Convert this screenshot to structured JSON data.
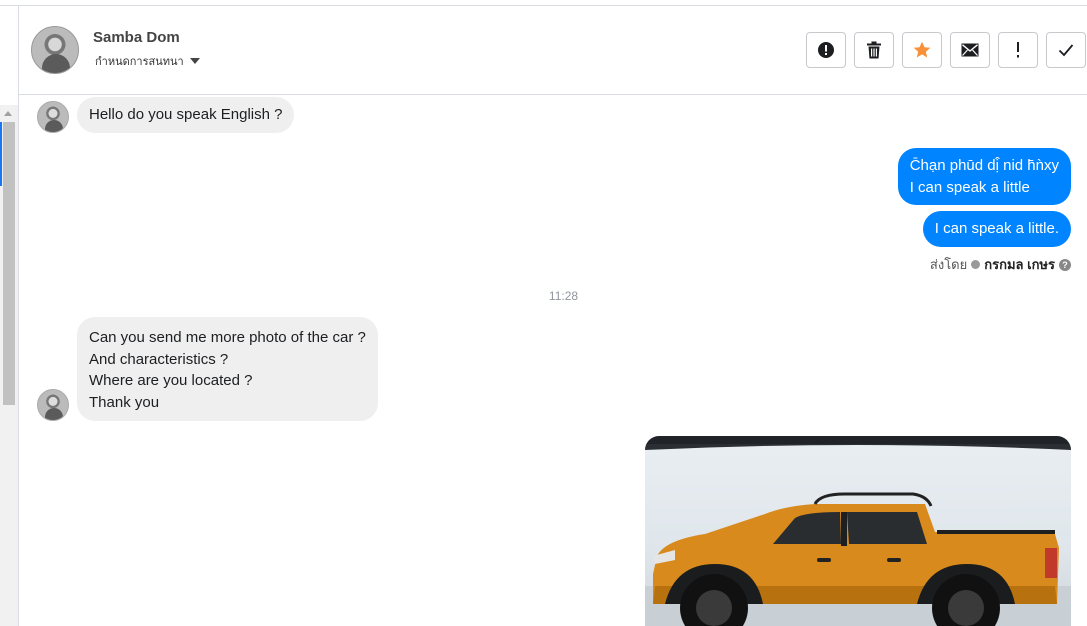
{
  "header": {
    "contact_name": "Samba Dom",
    "subtitle": "กำหนดการสนทนา",
    "actions": [
      {
        "name": "report-button",
        "icon": "exclamation-circle-icon"
      },
      {
        "name": "delete-button",
        "icon": "trash-icon"
      },
      {
        "name": "star-button",
        "icon": "star-icon",
        "color": "#f7923a"
      },
      {
        "name": "mark-unread-button",
        "icon": "envelope-icon"
      },
      {
        "name": "spam-button",
        "icon": "exclamation-icon"
      },
      {
        "name": "done-button",
        "icon": "check-icon"
      }
    ]
  },
  "messages": {
    "m1": "Hello do you speak English ?",
    "m2": "C̄hạn phūd dị̂ nid h̄ǹxy\nI can speak a little",
    "m3": "I can speak a little.",
    "sent_by_prefix": "ส่งโดย",
    "sent_by_name": "กรกมล เกษร",
    "help": "?",
    "timestamp": "11:28",
    "m4": "Can you send me more photo of the car ?\nAnd characteristics ?\nWhere are you located ?\nThank you"
  },
  "colors": {
    "outgoing_bubble": "#0084ff",
    "incoming_bubble": "#efefef",
    "star": "#f7923a"
  }
}
